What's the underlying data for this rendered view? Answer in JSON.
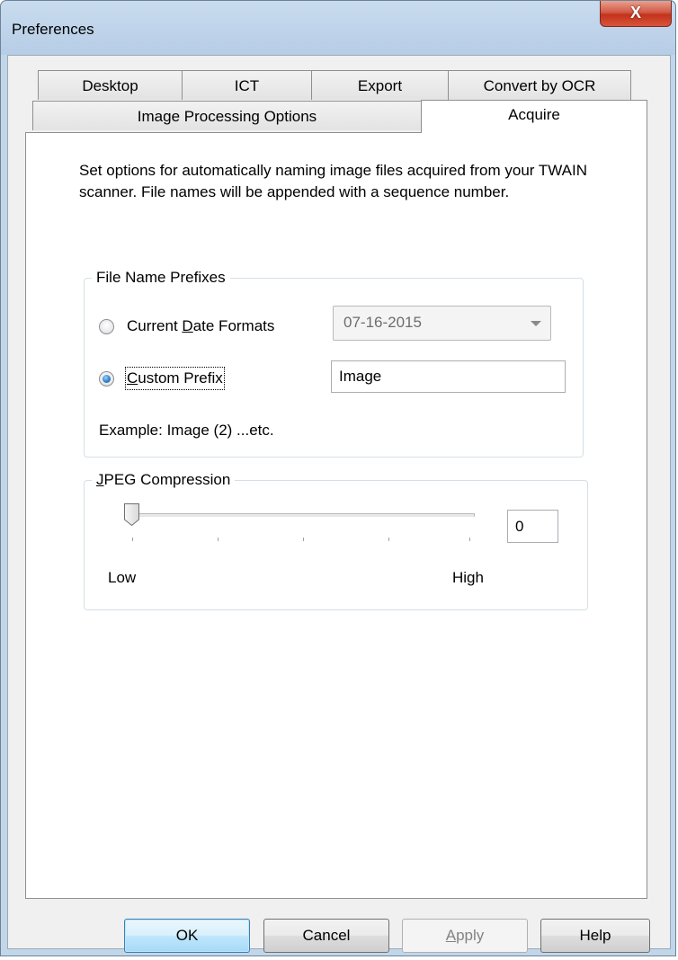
{
  "window": {
    "title": "Preferences",
    "close_glyph": "X"
  },
  "tabs": {
    "row1": [
      "Desktop",
      "ICT",
      "Export",
      "Convert by OCR"
    ],
    "row2": [
      "Image Processing Options",
      "Acquire"
    ],
    "active": "Acquire"
  },
  "acquire": {
    "description": "Set options for automatically naming image files acquired from your TWAIN scanner. File names will be appended with a sequence number.",
    "file_name_prefixes": {
      "label": "File Name Prefixes",
      "date_radio": {
        "pre": "Current ",
        "ul": "D",
        "post": "ate Formats",
        "checked": false
      },
      "date_format_value": "07-16-2015",
      "custom_radio": {
        "ul": "C",
        "post": "ustom Prefix",
        "checked": true
      },
      "custom_prefix_value": "Image",
      "example": "Example: Image (2) ...etc."
    },
    "jpeg_compression": {
      "label_ul": "J",
      "label_post": "PEG Compression",
      "slider_value": 0,
      "value_text": "0",
      "low_label": "Low",
      "high_label": "High"
    }
  },
  "buttons": {
    "ok": "OK",
    "cancel": "Cancel",
    "apply_ul": "A",
    "apply_post": "pply",
    "help": "Help"
  },
  "colors": {
    "accent": "#3c7fb1",
    "close": "#c2321c"
  }
}
